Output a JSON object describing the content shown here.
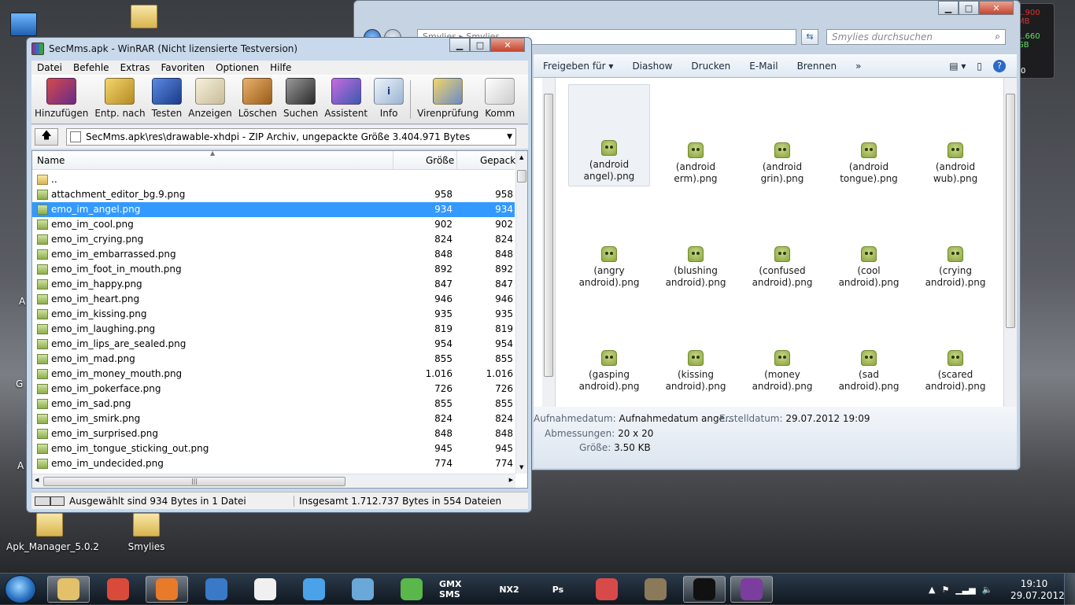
{
  "desktop": {
    "icons": [
      {
        "label": "Apk_Manager_5.0.2"
      },
      {
        "label": "Smylies"
      }
    ],
    "edge_letters": [
      "A",
      "G",
      "A"
    ]
  },
  "gadget": {
    "ram": "...900 MB",
    "disk": "1.660 GB",
    "small": "0"
  },
  "explorer": {
    "address": "Smylies ▸ Smylies",
    "search_placeholder": "Smylies durchsuchen",
    "toolbar": [
      "Freigeben für ▾",
      "Diashow",
      "Drucken",
      "E-Mail",
      "Brennen",
      "»"
    ],
    "items": [
      {
        "label": "(android angel).png"
      },
      {
        "label": "(android erm).png"
      },
      {
        "label": "(android grin).png"
      },
      {
        "label": "(android tongue).png"
      },
      {
        "label": "(android wub).png"
      },
      {
        "label": "(angry android).png"
      },
      {
        "label": "(blushing android).png"
      },
      {
        "label": "(confused android).png"
      },
      {
        "label": "(cool android).png"
      },
      {
        "label": "(crying android).png"
      },
      {
        "label": "(gasping android).png"
      },
      {
        "label": "(kissing android).png"
      },
      {
        "label": "(money android).png"
      },
      {
        "label": "(sad android).png"
      },
      {
        "label": "(scared android).png"
      }
    ],
    "details": {
      "aufnahme_label": "Aufnahmedatum:",
      "aufnahme_value": "Aufnahmedatum ange...",
      "erstell_label": "Erstelldatum:",
      "erstell_value": "29.07.2012 19:09",
      "abm_label": "Abmessungen:",
      "abm_value": "20 x 20",
      "groesse_label": "Größe:",
      "groesse_value": "3.50 KB"
    }
  },
  "winrar": {
    "title": "SecMms.apk - WinRAR (Nicht lizensierte Testversion)",
    "menu": [
      "Datei",
      "Befehle",
      "Extras",
      "Favoriten",
      "Optionen",
      "Hilfe"
    ],
    "toolbar": [
      {
        "label": "Hinzufügen",
        "color": "#b33a3a"
      },
      {
        "label": "Entp. nach",
        "color": "#d6b13a"
      },
      {
        "label": "Testen",
        "color": "#2c58b8"
      },
      {
        "label": "Anzeigen",
        "color": "#e8e0c8"
      },
      {
        "label": "Löschen",
        "color": "#c98a3a"
      },
      {
        "label": "Suchen",
        "color": "#5a5a5a"
      },
      {
        "label": "Assistent",
        "color": "#8e3ab8"
      },
      {
        "label": "Info",
        "color": "#cfdcec"
      },
      {
        "label": "Virenprüfung",
        "color": "#c8a040"
      },
      {
        "label": "Komm",
        "color": "#eeeeee"
      }
    ],
    "path": "SecMms.apk\\res\\drawable-xhdpi - ZIP Archiv, ungepackte Größe 3.404.971 Bytes",
    "columns": {
      "name": "Name",
      "size": "Größe",
      "packed": "Gepack"
    },
    "files": [
      {
        "name": "..",
        "size": "",
        "packed": ""
      },
      {
        "name": "attachment_editor_bg.9.png",
        "size": "958",
        "packed": "958"
      },
      {
        "name": "emo_im_angel.png",
        "size": "934",
        "packed": "934"
      },
      {
        "name": "emo_im_cool.png",
        "size": "902",
        "packed": "902"
      },
      {
        "name": "emo_im_crying.png",
        "size": "824",
        "packed": "824"
      },
      {
        "name": "emo_im_embarrassed.png",
        "size": "848",
        "packed": "848"
      },
      {
        "name": "emo_im_foot_in_mouth.png",
        "size": "892",
        "packed": "892"
      },
      {
        "name": "emo_im_happy.png",
        "size": "847",
        "packed": "847"
      },
      {
        "name": "emo_im_heart.png",
        "size": "946",
        "packed": "946"
      },
      {
        "name": "emo_im_kissing.png",
        "size": "935",
        "packed": "935"
      },
      {
        "name": "emo_im_laughing.png",
        "size": "819",
        "packed": "819"
      },
      {
        "name": "emo_im_lips_are_sealed.png",
        "size": "954",
        "packed": "954"
      },
      {
        "name": "emo_im_mad.png",
        "size": "855",
        "packed": "855"
      },
      {
        "name": "emo_im_money_mouth.png",
        "size": "1.016",
        "packed": "1.016"
      },
      {
        "name": "emo_im_pokerface.png",
        "size": "726",
        "packed": "726"
      },
      {
        "name": "emo_im_sad.png",
        "size": "855",
        "packed": "855"
      },
      {
        "name": "emo_im_smirk.png",
        "size": "824",
        "packed": "824"
      },
      {
        "name": "emo_im_surprised.png",
        "size": "848",
        "packed": "848"
      },
      {
        "name": "emo_im_tongue_sticking_out.png",
        "size": "945",
        "packed": "945"
      },
      {
        "name": "emo_im_undecided.png",
        "size": "774",
        "packed": "774"
      }
    ],
    "status_left": "Ausgewählt sind 934 Bytes in 1 Datei",
    "status_right": "Insgesamt 1.712.737 Bytes in 554 Dateien"
  },
  "taskbar": {
    "apps": [
      {
        "icon": "explorer-icon",
        "color": "#e3c06a"
      },
      {
        "icon": "chrome-icon",
        "color": "#d94a3a"
      },
      {
        "icon": "firefox-icon",
        "color": "#e87a2a"
      },
      {
        "icon": "thunderbird-icon",
        "color": "#3a78c8"
      },
      {
        "icon": "fox-mask-icon",
        "color": "#f0f0f0"
      },
      {
        "icon": "dropbox-icon",
        "color": "#4aa3e8"
      },
      {
        "icon": "network-icon",
        "color": "#6aa8d8"
      },
      {
        "icon": "cup-icon",
        "color": "#5ab84a"
      },
      {
        "icon": "gmx-sms-icon",
        "text": "GMX SMS"
      },
      {
        "icon": "nx2-icon",
        "text": "NX2"
      },
      {
        "icon": "photoshop-icon",
        "text": "Ps"
      },
      {
        "icon": "paint-icon",
        "color": "#d84a4a"
      },
      {
        "icon": "gimp-icon",
        "color": "#8a7a5a"
      },
      {
        "icon": "cmd-icon",
        "color": "#111111"
      },
      {
        "icon": "winrar-icon",
        "color": "#7b3d9e"
      }
    ],
    "time": "19:10",
    "date": "29.07.2012"
  }
}
